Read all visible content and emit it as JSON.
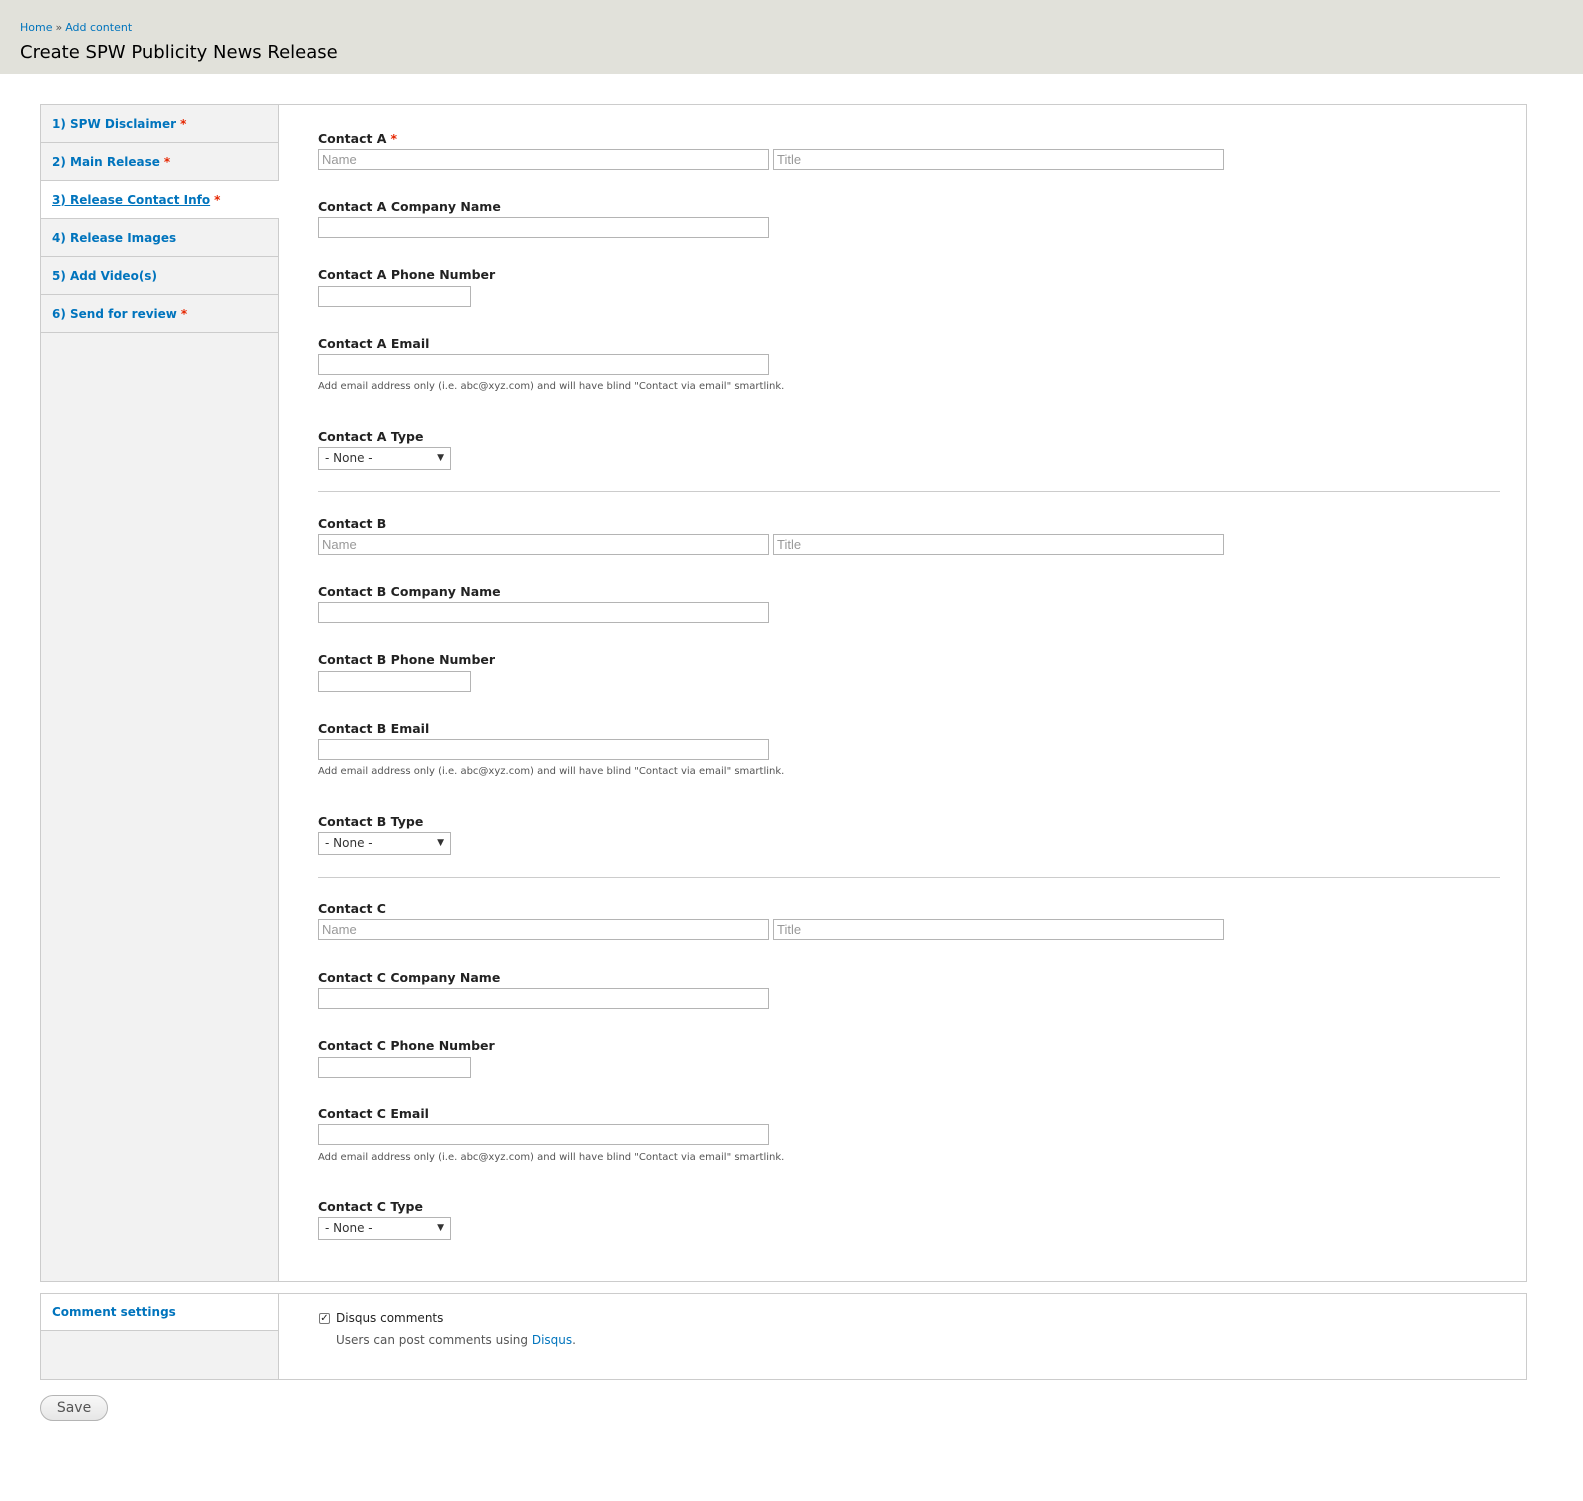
{
  "breadcrumb": {
    "home": "Home",
    "separator": "»",
    "add_content": "Add content"
  },
  "page_title": "Create SPW Publicity News Release",
  "tabs": [
    {
      "label": "1) SPW Disclaimer",
      "required": "*"
    },
    {
      "label": "2) Main Release",
      "required": "*"
    },
    {
      "label": "3) Release Contact Info",
      "required": "*"
    },
    {
      "label": "4) Release Images",
      "required": ""
    },
    {
      "label": "5) Add Video(s)",
      "required": ""
    },
    {
      "label": "6) Send for review",
      "required": "*"
    }
  ],
  "contacts": {
    "a": {
      "label": "Contact A",
      "required": "*",
      "name_placeholder": "Name",
      "title_placeholder": "Title",
      "company_label": "Contact A Company Name",
      "phone_label": "Contact A Phone Number",
      "email_label": "Contact A Email",
      "email_desc": "Add email address only (i.e. abc@xyz.com) and will have blind \"Contact via email\" smartlink.",
      "type_label": "Contact A Type",
      "type_value": "- None -"
    },
    "b": {
      "label": "Contact B",
      "name_placeholder": "Name",
      "title_placeholder": "Title",
      "company_label": "Contact B Company Name",
      "phone_label": "Contact B Phone Number",
      "email_label": "Contact B Email",
      "email_desc": "Add email address only (i.e. abc@xyz.com) and will have blind \"Contact via email\" smartlink.",
      "type_label": "Contact B Type",
      "type_value": "- None -"
    },
    "c": {
      "label": "Contact C",
      "name_placeholder": "Name",
      "title_placeholder": "Title",
      "company_label": "Contact C Company Name",
      "phone_label": "Contact C Phone Number",
      "email_label": "Contact C Email",
      "email_desc": "Add email address only (i.e. abc@xyz.com) and will have blind \"Contact via email\" smartlink.",
      "type_label": "Contact C Type",
      "type_value": "- None -"
    }
  },
  "comment_settings": {
    "tab_label": "Comment settings",
    "checkbox_label": "Disqus comments",
    "checked": true,
    "desc_prefix": "Users can post comments using",
    "desc_link": "Disqus",
    "desc_suffix": "."
  },
  "save_label": "Save",
  "colors": {
    "link": "#0074bd",
    "required": "#e62600",
    "header_bg": "#e1e1da",
    "tab_bg": "#f2f2f2"
  }
}
